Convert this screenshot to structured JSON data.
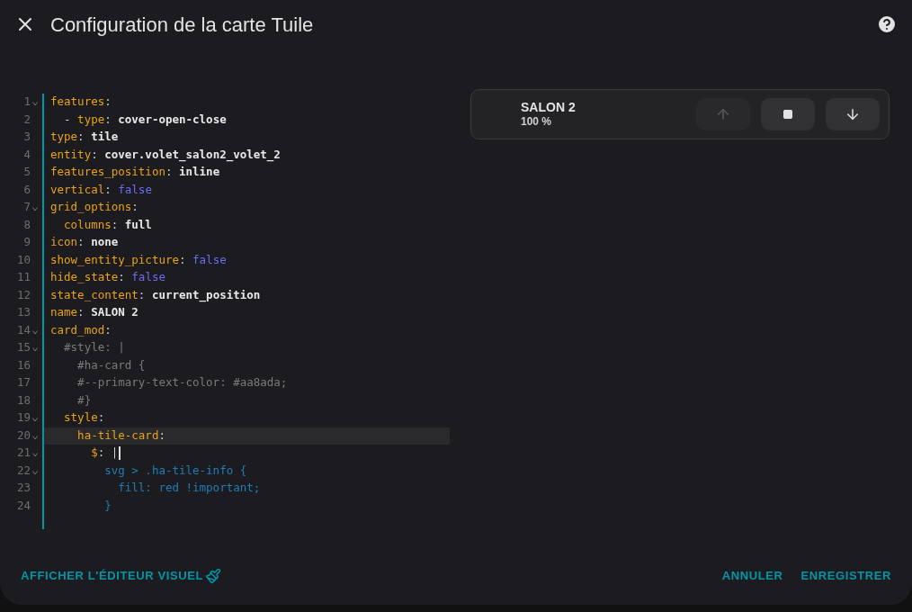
{
  "dialog": {
    "title": "Configuration de la carte Tuile"
  },
  "editor": {
    "lines": [
      {
        "number": "1",
        "foldable": true,
        "active": false,
        "cursor": false,
        "tokens": [
          {
            "kind": "key",
            "text": "features"
          },
          {
            "kind": "punct",
            "text": ":"
          }
        ]
      },
      {
        "number": "2",
        "foldable": false,
        "active": false,
        "cursor": false,
        "tokens": [
          {
            "kind": "punct",
            "text": "  - "
          },
          {
            "kind": "key",
            "text": "type"
          },
          {
            "kind": "punct",
            "text": ": "
          },
          {
            "kind": "value",
            "text": "cover-open-close"
          }
        ]
      },
      {
        "number": "3",
        "foldable": false,
        "active": false,
        "cursor": false,
        "tokens": [
          {
            "kind": "key",
            "text": "type"
          },
          {
            "kind": "punct",
            "text": ": "
          },
          {
            "kind": "value",
            "text": "tile"
          }
        ]
      },
      {
        "number": "4",
        "foldable": false,
        "active": false,
        "cursor": false,
        "tokens": [
          {
            "kind": "key",
            "text": "entity"
          },
          {
            "kind": "punct",
            "text": ": "
          },
          {
            "kind": "value",
            "text": "cover.volet_salon2_volet_2"
          }
        ]
      },
      {
        "number": "5",
        "foldable": false,
        "active": false,
        "cursor": false,
        "tokens": [
          {
            "kind": "key",
            "text": "features_position"
          },
          {
            "kind": "punct",
            "text": ": "
          },
          {
            "kind": "value",
            "text": "inline"
          }
        ]
      },
      {
        "number": "6",
        "foldable": false,
        "active": false,
        "cursor": false,
        "tokens": [
          {
            "kind": "key",
            "text": "vertical"
          },
          {
            "kind": "punct",
            "text": ": "
          },
          {
            "kind": "bool",
            "text": "false"
          }
        ]
      },
      {
        "number": "7",
        "foldable": true,
        "active": false,
        "cursor": false,
        "tokens": [
          {
            "kind": "key",
            "text": "grid_options"
          },
          {
            "kind": "punct",
            "text": ":"
          }
        ]
      },
      {
        "number": "8",
        "foldable": false,
        "active": false,
        "cursor": false,
        "tokens": [
          {
            "kind": "key",
            "text": "  columns"
          },
          {
            "kind": "punct",
            "text": ": "
          },
          {
            "kind": "value",
            "text": "full"
          }
        ]
      },
      {
        "number": "9",
        "foldable": false,
        "active": false,
        "cursor": false,
        "tokens": [
          {
            "kind": "key",
            "text": "icon"
          },
          {
            "kind": "punct",
            "text": ": "
          },
          {
            "kind": "value",
            "text": "none"
          }
        ]
      },
      {
        "number": "10",
        "foldable": false,
        "active": false,
        "cursor": false,
        "tokens": [
          {
            "kind": "key",
            "text": "show_entity_picture"
          },
          {
            "kind": "punct",
            "text": ": "
          },
          {
            "kind": "bool",
            "text": "false"
          }
        ]
      },
      {
        "number": "11",
        "foldable": false,
        "active": false,
        "cursor": false,
        "tokens": [
          {
            "kind": "key",
            "text": "hide_state"
          },
          {
            "kind": "punct",
            "text": ": "
          },
          {
            "kind": "bool",
            "text": "false"
          }
        ]
      },
      {
        "number": "12",
        "foldable": false,
        "active": false,
        "cursor": false,
        "tokens": [
          {
            "kind": "key",
            "text": "state_content"
          },
          {
            "kind": "punct",
            "text": ": "
          },
          {
            "kind": "value",
            "text": "current_position"
          }
        ]
      },
      {
        "number": "13",
        "foldable": false,
        "active": false,
        "cursor": false,
        "tokens": [
          {
            "kind": "key",
            "text": "name"
          },
          {
            "kind": "punct",
            "text": ": "
          },
          {
            "kind": "value",
            "text": "SALON 2"
          }
        ]
      },
      {
        "number": "14",
        "foldable": true,
        "active": false,
        "cursor": false,
        "tokens": [
          {
            "kind": "key",
            "text": "card_mod"
          },
          {
            "kind": "punct",
            "text": ":"
          }
        ]
      },
      {
        "number": "15",
        "foldable": true,
        "active": false,
        "cursor": false,
        "tokens": [
          {
            "kind": "comment",
            "text": "  #style: |"
          }
        ]
      },
      {
        "number": "16",
        "foldable": false,
        "active": false,
        "cursor": false,
        "tokens": [
          {
            "kind": "comment",
            "text": "    #ha-card {"
          }
        ]
      },
      {
        "number": "17",
        "foldable": false,
        "active": false,
        "cursor": false,
        "tokens": [
          {
            "kind": "comment",
            "text": "    #--primary-text-color: #aa8ada;"
          }
        ]
      },
      {
        "number": "18",
        "foldable": false,
        "active": false,
        "cursor": false,
        "tokens": [
          {
            "kind": "comment",
            "text": "    #}"
          }
        ]
      },
      {
        "number": "19",
        "foldable": true,
        "active": false,
        "cursor": false,
        "tokens": [
          {
            "kind": "key",
            "text": "  style"
          },
          {
            "kind": "punct",
            "text": ":"
          }
        ]
      },
      {
        "number": "20",
        "foldable": true,
        "active": true,
        "cursor": false,
        "tokens": [
          {
            "kind": "key",
            "text": "    ha-tile-card"
          },
          {
            "kind": "punct",
            "text": ":"
          }
        ]
      },
      {
        "number": "21",
        "foldable": true,
        "active": false,
        "cursor": true,
        "tokens": [
          {
            "kind": "key",
            "text": "      $"
          },
          {
            "kind": "punct",
            "text": ": |"
          }
        ]
      },
      {
        "number": "22",
        "foldable": true,
        "active": false,
        "cursor": false,
        "tokens": [
          {
            "kind": "css",
            "text": "        svg > .ha-tile-info {"
          }
        ]
      },
      {
        "number": "23",
        "foldable": false,
        "active": false,
        "cursor": false,
        "tokens": [
          {
            "kind": "css",
            "text": "          fill: red !important;"
          }
        ]
      },
      {
        "number": "24",
        "foldable": false,
        "active": false,
        "cursor": false,
        "tokens": [
          {
            "kind": "css",
            "text": "        }"
          }
        ]
      }
    ]
  },
  "preview": {
    "name": "SALON 2",
    "state": "100 %",
    "controls": [
      {
        "kind": "open",
        "disabled": true
      },
      {
        "kind": "stop",
        "disabled": false
      },
      {
        "kind": "close",
        "disabled": false
      }
    ]
  },
  "footer": {
    "visual_editor": "AFFICHER L'ÉDITEUR VISUEL",
    "cancel": "ANNULER",
    "save": "ENREGISTRER"
  }
}
